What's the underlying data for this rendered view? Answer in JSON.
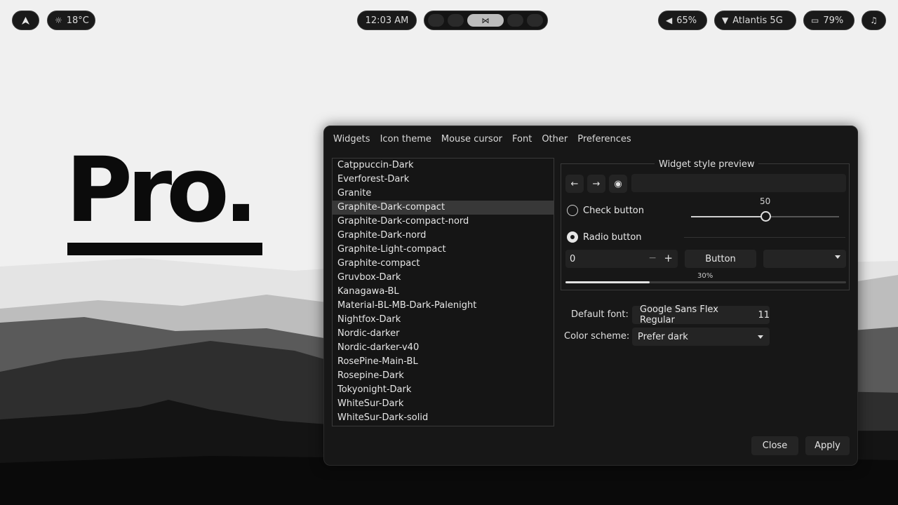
{
  "topbar": {
    "launcher_icon": "arch-logo-icon",
    "weather": {
      "icon": "sun-icon",
      "temp": "18°C"
    },
    "clock": "12:03 AM",
    "workspace_active_icon": "vscode-icon",
    "volume": {
      "icon": "volume-icon",
      "value": "65%"
    },
    "wifi": {
      "icon": "wifi-icon",
      "ssid": "Atlantis 5G"
    },
    "battery": {
      "icon": "battery-icon",
      "value": "79%"
    },
    "notif_icon": "bell-icon"
  },
  "wallpaper": {
    "brand_text": "Pro."
  },
  "dialog": {
    "tabs": [
      "Widgets",
      "Icon theme",
      "Mouse cursor",
      "Font",
      "Other",
      "Preferences"
    ],
    "themes": [
      "Catppuccin-Dark",
      "Everforest-Dark",
      "Granite",
      "Graphite-Dark-compact",
      "Graphite-Dark-compact-nord",
      "Graphite-Dark-nord",
      "Graphite-Light-compact",
      "Graphite-compact",
      "Gruvbox-Dark",
      "Kanagawa-BL",
      "Material-BL-MB-Dark-Palenight",
      "Nightfox-Dark",
      "Nordic-darker",
      "Nordic-darker-v40",
      "RosePine-Main-BL",
      "Rosepine-Dark",
      "Tokyonight-Dark",
      "WhiteSur-Dark",
      "WhiteSur-Dark-solid"
    ],
    "selected_theme_index": 3,
    "preview": {
      "title": "Widget style preview",
      "check_label": "Check button",
      "radio_label": "Radio button",
      "slider_value": "50",
      "slider_fraction": 0.5,
      "spin_value": "0",
      "spin_minus": "−",
      "spin_plus": "+",
      "button_label": "Button",
      "progress_label": "30%",
      "progress_fraction": 0.3
    },
    "default_font_label": "Default font:",
    "default_font_name": "Google Sans Flex Regular",
    "default_font_size": "11",
    "color_scheme_label": "Color scheme:",
    "color_scheme_value": "Prefer dark",
    "close_label": "Close",
    "apply_label": "Apply"
  }
}
